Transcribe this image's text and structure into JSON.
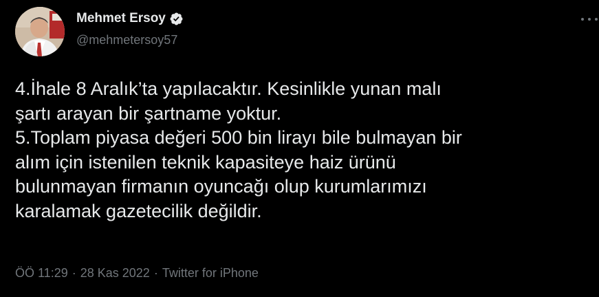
{
  "author": {
    "display_name": "Mehmet Ersoy",
    "handle": "@mehmetersoy57",
    "verified": true,
    "verified_color": "#1d9bf0"
  },
  "tweet": {
    "lines": [
      "4.İhale 8 Aralık’ta yapılacaktır. Kesinlikle yunan malı",
      "şartı arayan bir şartname yoktur.",
      "5.Toplam piyasa değeri 500 bin lirayı bile bulmayan bir",
      "alım için istenilen teknik kapasiteye haiz ürünü",
      "bulunmayan firmanın oyuncağı olup kurumlarımızı",
      "karalamak gazetecilik değildir."
    ]
  },
  "meta": {
    "time": "ÖÖ 11:29",
    "separator": "·",
    "date": "28 Kas 2022",
    "source": "Twitter for iPhone"
  },
  "icons": {
    "avatar": "avatar-photo",
    "verified": "verified-badge-icon",
    "more": "more-options-icon"
  },
  "colors": {
    "background": "#000000",
    "text": "#e7e9ea",
    "secondary_text": "#71767b"
  }
}
